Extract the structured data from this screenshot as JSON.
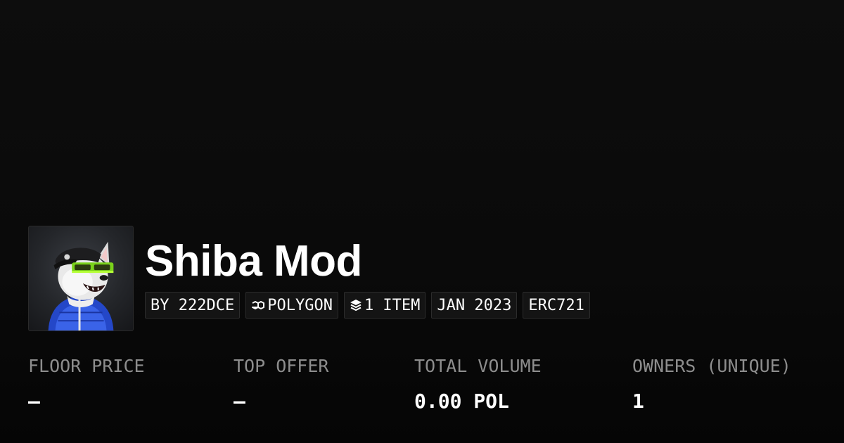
{
  "collection": {
    "title": "Shiba Mod",
    "avatar_icon": "shiba-dog-avatar",
    "tags": {
      "creator": "BY 222DCE",
      "chain": "POLYGON",
      "chain_icon": "polygon-chain-icon",
      "items": "1 ITEM",
      "items_icon": "layers-icon",
      "date": "JAN 2023",
      "standard": "ERC721"
    }
  },
  "stats": [
    {
      "label": "FLOOR PRICE",
      "value": "–"
    },
    {
      "label": "TOP OFFER",
      "value": "–"
    },
    {
      "label": "TOTAL VOLUME",
      "value": "0.00 POL"
    },
    {
      "label": "OWNERS (UNIQUE)",
      "value": "1"
    }
  ],
  "colors": {
    "background": "#0a0a0a",
    "text": "#ffffff",
    "muted": "#8d8d8d",
    "accent_green": "#8cf21e"
  }
}
